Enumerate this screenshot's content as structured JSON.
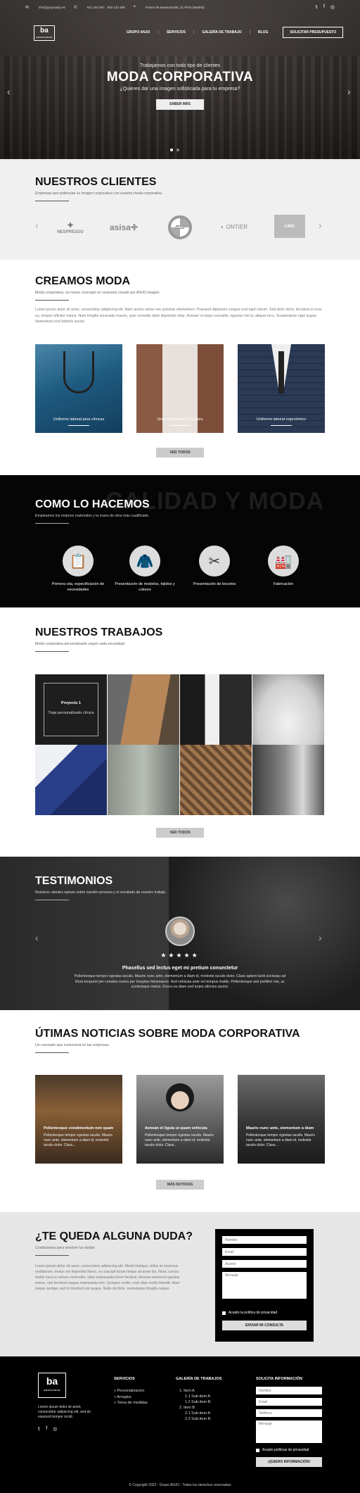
{
  "topbar": {
    "email": "info@grupoanjo.es",
    "phone": "911 234 567 · 600 123 456",
    "address": "Puerto de Navacerrada, 21 Pinto (Madrid)"
  },
  "brand": {
    "logo_text": "ba",
    "logo_sub": "GRUPOANJO"
  },
  "nav": {
    "items": [
      "GRUPO ANJO",
      "SERVICIOS",
      "GALERÍA DE TRABAJO",
      "BLOG"
    ],
    "cta": "SOLICITAR PRESUPUESTO"
  },
  "hero": {
    "kicker": "Trabajamos con todo tipo de clientes",
    "title": "MODA CORPORATIVA",
    "subtitle": "¿Quieres dar una imagen sofisticada para tu empresa?",
    "button": "SABER MÁS"
  },
  "clients": {
    "title": "NUESTROS CLIENTES",
    "subtitle": "Empresas que potencian su imagen corporativa con nuestra moda corporativa",
    "logos": [
      "NESPRESSO",
      "asisa",
      "BMW",
      "ONTIER",
      "LIMA"
    ]
  },
  "creamos": {
    "title": "CREAMOS MODA",
    "subtitle": "Moda corporativa, un nuevo concepto en vestuario creado por ANJO Imagen",
    "body": "Lorem ipsum dolor sit amet, consectetur adipiscing elit. Nam auctor metus nec pulvinar elementum. Praesent dignissim congue erat eget rutrum. Sed dolor dolor, tincidunt et eros eu, tempor efficitur metus. Nam fringilla venenatis mauris, quis convallis diam dignissim vitae. Aenean ut turpis convallis, egestas nisi id, aliquet arcu. Suspendisse eget augue elementum erat lobortis auctor.",
    "cards": [
      "Uniforme laboral para clínicas",
      "Uniforme laboral ecológico",
      "Uniforme laboral ergonómico"
    ],
    "button": "VER TODOS"
  },
  "como": {
    "watermark": "CALIDAD Y MODA",
    "title": "COMO LO HACEMOS",
    "subtitle": "Empleamos los mejores materiales y la mano de obra más cualificada",
    "steps": [
      "Primera cita, especificación de necesidades",
      "Presentación de modelos, tejidos y colores",
      "Presentación de bocetos",
      "Fabricación"
    ]
  },
  "trabajos": {
    "title": "NUESTROS TRABAJOS",
    "subtitle": "Moda corporativa personalizada según cada necesidad",
    "overlay_title": "Proyecto 1",
    "overlay_sub": "Traje personalizado clínica",
    "button": "VER TODOS"
  },
  "testimonios": {
    "title": "TESTIMONIOS",
    "subtitle": "Nuestros clientes opinan sobre nuestro proceso y el resultado de nuestro trabajo",
    "stars": "★★★★★",
    "rating": 5,
    "quote_title": "Phasellus sed lectus eget mi pretium consectetur",
    "quote_body": "Pellentesque tempor egestas iaculis. Mauris nunc ante, elementum a diam id, molestie iaculis dolor. Class aptent taciti sociosqu ad litora torquent per conubia nostra per inceptos himenaeos. Sed vehicula ante vel tempus mattis. Pellentesque sed porttitor nisi, ac scelerisque metus. Fusce eu diam sed turpis ultricies auctor."
  },
  "noticias": {
    "title": "ÚTIMAS NOTICIAS SOBRE MODA CORPORATIVA",
    "subtitle": "Un concepto que evoluciona en las empresas",
    "items": [
      {
        "title": "Pellentesque condimentum non quam",
        "body": "Pellentesque tempor egestas iaculis. Mauris nunc ante, elementum a diam id, molestie iaculis dolor. Class..."
      },
      {
        "title": "Aenean et ligula ut quam vehicula",
        "body": "Pellentesque tempor egestas iaculis. Mauris nunc ante, elementum a diam id, molestie iaculis dolor. Class..."
      },
      {
        "title": "Mauris nunc ante, elementum a diam",
        "body": "Pellentesque tempor egestas iaculis. Mauris nunc ante, elementum a diam id, molestie iaculis dolor. Class..."
      }
    ],
    "button": "MÁS NOTICIAS"
  },
  "duda": {
    "title": "¿TE QUEDA ALGUNA DUDA?",
    "subtitle": "Contáctanos para resolver tus dudas",
    "body": "Lorem ipsum dolor sit amet, consectetur adipiscing elit. Morbi tristique, tellus at maximus vestibulum, metus est imperdiet libero, eu suscipit turpis neque sit amet dui. Nunc cursus mollis risus in rutrum venenatis, vitae malesuada lorem facilisis. Aenean euismod egestas metus, sed tincidunt augue malesuada non. Quisque mollis, erat vitae mollis blandit, diam neque semper sed ut tincidunt est augue. Nulla dui felis, scelerisque fringilla neque.",
    "form": {
      "name_ph": "Nombre",
      "email_ph": "Email",
      "subject_ph": "Asunto",
      "message_ph": "Mensaje",
      "privacy": "Acepto la política de privacidad",
      "submit": "ENVIAR MI CONSULTA"
    }
  },
  "footer": {
    "about": "Lorem ipsum dolor sit amet, consectetur adipiscing elit, sed do eiusmod tempor incidi.",
    "servicios_title": "SERVICIOS",
    "servicios": [
      "Personalización",
      "Arreglos",
      "Toma de medidas"
    ],
    "galeria_title": "GALERÍA DE TRABAJOS",
    "galeria": [
      "1. Item A",
      "1.1 Sub-item A",
      "1.2 Sub-item B",
      "2. Item B",
      "2.1 Sub-item A",
      "2.2 Sub-item B"
    ],
    "info_title": "SOLICITA INFORMACIÓN",
    "form": {
      "name_ph": "Nombre",
      "email_ph": "Email",
      "phone_ph": "Teléfono",
      "message_ph": "Mensaje",
      "privacy": "Acepto políticas de privacidad",
      "submit": "¡QUIERO INFORMACIÓN!"
    },
    "copyright": "© Copyright 2022 - Grupo ANJO - Todos los derechos reservados"
  }
}
